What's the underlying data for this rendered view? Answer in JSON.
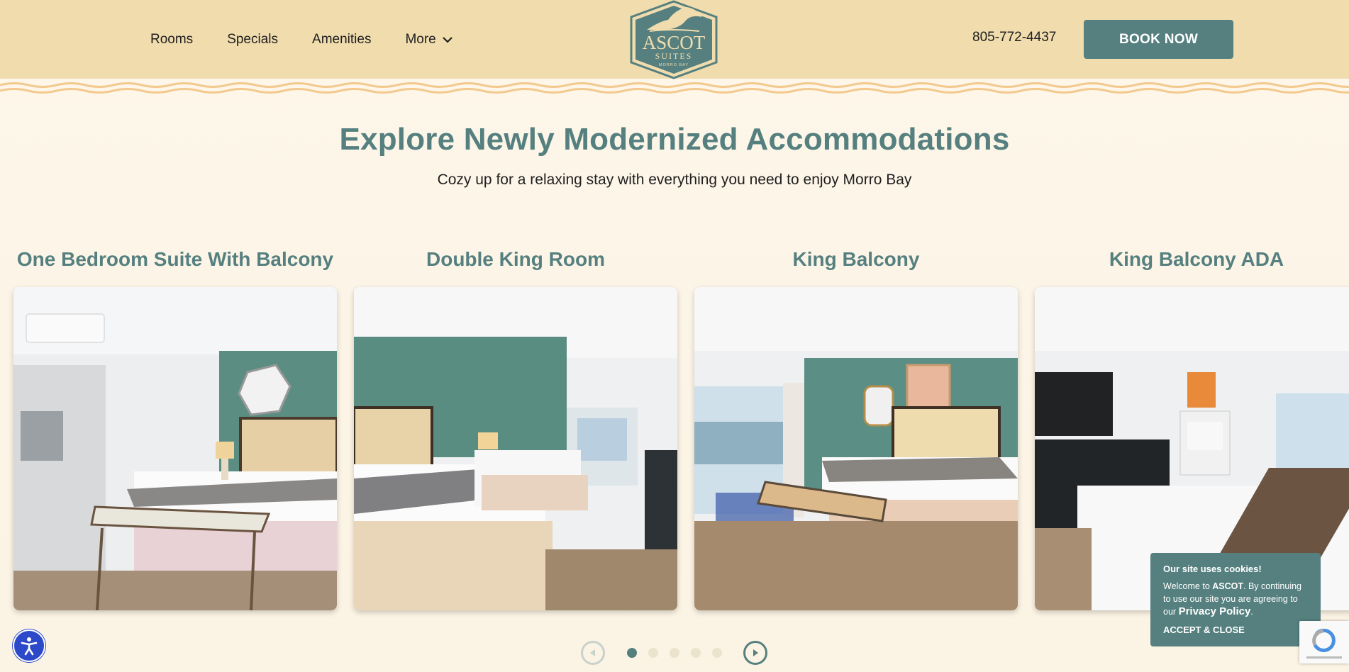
{
  "nav": {
    "items": [
      {
        "label": "Rooms"
      },
      {
        "label": "Specials"
      },
      {
        "label": "Amenities"
      },
      {
        "label": "More"
      }
    ]
  },
  "logo": {
    "line1": "ASCOT",
    "line2": "SUITES",
    "line3": "MORRO BAY"
  },
  "phone": "805-772-4437",
  "book_button": "BOOK NOW",
  "heading": {
    "title": "Explore Newly Modernized Accommodations",
    "subtitle": "Cozy up for a relaxing stay with everything you need to enjoy Morro Bay"
  },
  "rooms": [
    {
      "title": "One Bedroom Suite With Balcony"
    },
    {
      "title": "Double King Room"
    },
    {
      "title": "King Balcony"
    },
    {
      "title": "King Balcony ADA"
    }
  ],
  "carousel": {
    "pages": 5,
    "active_index": 0
  },
  "cookie": {
    "title": "Our site uses cookies!",
    "text_before": "Welcome to ",
    "brand": "ASCOT",
    "text_after": ". By continuing to use our site you are agreeing to our",
    "policy_link": "Privacy Policy",
    "period": ".",
    "accept": "ACCEPT & CLOSE"
  },
  "colors": {
    "accent": "#55807f",
    "header_bg": "#f1dcae",
    "page_bg": "#fdf6ea"
  },
  "icons": [
    "chevron-down-icon",
    "arrow-left-icon",
    "arrow-right-icon",
    "accessibility-icon",
    "recaptcha-icon"
  ]
}
